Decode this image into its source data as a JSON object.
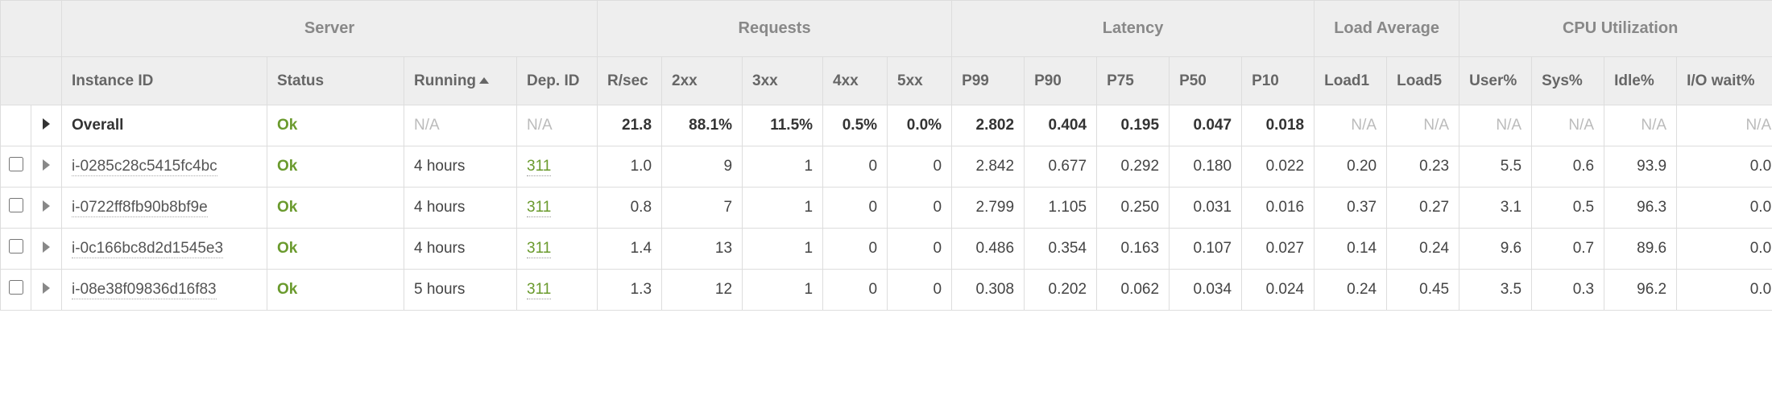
{
  "headers": {
    "groups": {
      "server": "Server",
      "requests": "Requests",
      "latency": "Latency",
      "load": "Load Average",
      "cpu": "CPU Utilization"
    },
    "cols": {
      "instance_id": "Instance ID",
      "status": "Status",
      "running": "Running",
      "dep_id": "Dep. ID",
      "rsec": "R/sec",
      "c2xx": "2xx",
      "c3xx": "3xx",
      "c4xx": "4xx",
      "c5xx": "5xx",
      "p99": "P99",
      "p90": "P90",
      "p75": "P75",
      "p50": "P50",
      "p10": "P10",
      "load1": "Load1",
      "load5": "Load5",
      "user": "User%",
      "sys": "Sys%",
      "idle": "Idle%",
      "iowait": "I/O wait%"
    }
  },
  "overall": {
    "label": "Overall",
    "status": "Ok",
    "running": "N/A",
    "dep_id": "N/A",
    "rsec": "21.8",
    "c2xx": "88.1%",
    "c3xx": "11.5%",
    "c4xx": "0.5%",
    "c5xx": "0.0%",
    "p99": "2.802",
    "p90": "0.404",
    "p75": "0.195",
    "p50": "0.047",
    "p10": "0.018",
    "load1": "N/A",
    "load5": "N/A",
    "user": "N/A",
    "sys": "N/A",
    "idle": "N/A",
    "iowait": "N/A"
  },
  "rows": [
    {
      "instance_id": "i-0285c28c5415fc4bc",
      "status": "Ok",
      "running": "4 hours",
      "dep_id": "311",
      "rsec": "1.0",
      "c2xx": "9",
      "c3xx": "1",
      "c4xx": "0",
      "c5xx": "0",
      "p99": "2.842",
      "p90": "0.677",
      "p75": "0.292",
      "p50": "0.180",
      "p10": "0.022",
      "load1": "0.20",
      "load5": "0.23",
      "user": "5.5",
      "sys": "0.6",
      "idle": "93.9",
      "iowait": "0.0"
    },
    {
      "instance_id": "i-0722ff8fb90b8bf9e",
      "status": "Ok",
      "running": "4 hours",
      "dep_id": "311",
      "rsec": "0.8",
      "c2xx": "7",
      "c3xx": "1",
      "c4xx": "0",
      "c5xx": "0",
      "p99": "2.799",
      "p90": "1.105",
      "p75": "0.250",
      "p50": "0.031",
      "p10": "0.016",
      "load1": "0.37",
      "load5": "0.27",
      "user": "3.1",
      "sys": "0.5",
      "idle": "96.3",
      "iowait": "0.0"
    },
    {
      "instance_id": "i-0c166bc8d2d1545e3",
      "status": "Ok",
      "running": "4 hours",
      "dep_id": "311",
      "rsec": "1.4",
      "c2xx": "13",
      "c3xx": "1",
      "c4xx": "0",
      "c5xx": "0",
      "p99": "0.486",
      "p90": "0.354",
      "p75": "0.163",
      "p50": "0.107",
      "p10": "0.027",
      "load1": "0.14",
      "load5": "0.24",
      "user": "9.6",
      "sys": "0.7",
      "idle": "89.6",
      "iowait": "0.0"
    },
    {
      "instance_id": "i-08e38f09836d16f83",
      "status": "Ok",
      "running": "5 hours",
      "dep_id": "311",
      "rsec": "1.3",
      "c2xx": "12",
      "c3xx": "1",
      "c4xx": "0",
      "c5xx": "0",
      "p99": "0.308",
      "p90": "0.202",
      "p75": "0.062",
      "p50": "0.034",
      "p10": "0.024",
      "load1": "0.24",
      "load5": "0.45",
      "user": "3.5",
      "sys": "0.3",
      "idle": "96.2",
      "iowait": "0.0"
    }
  ]
}
